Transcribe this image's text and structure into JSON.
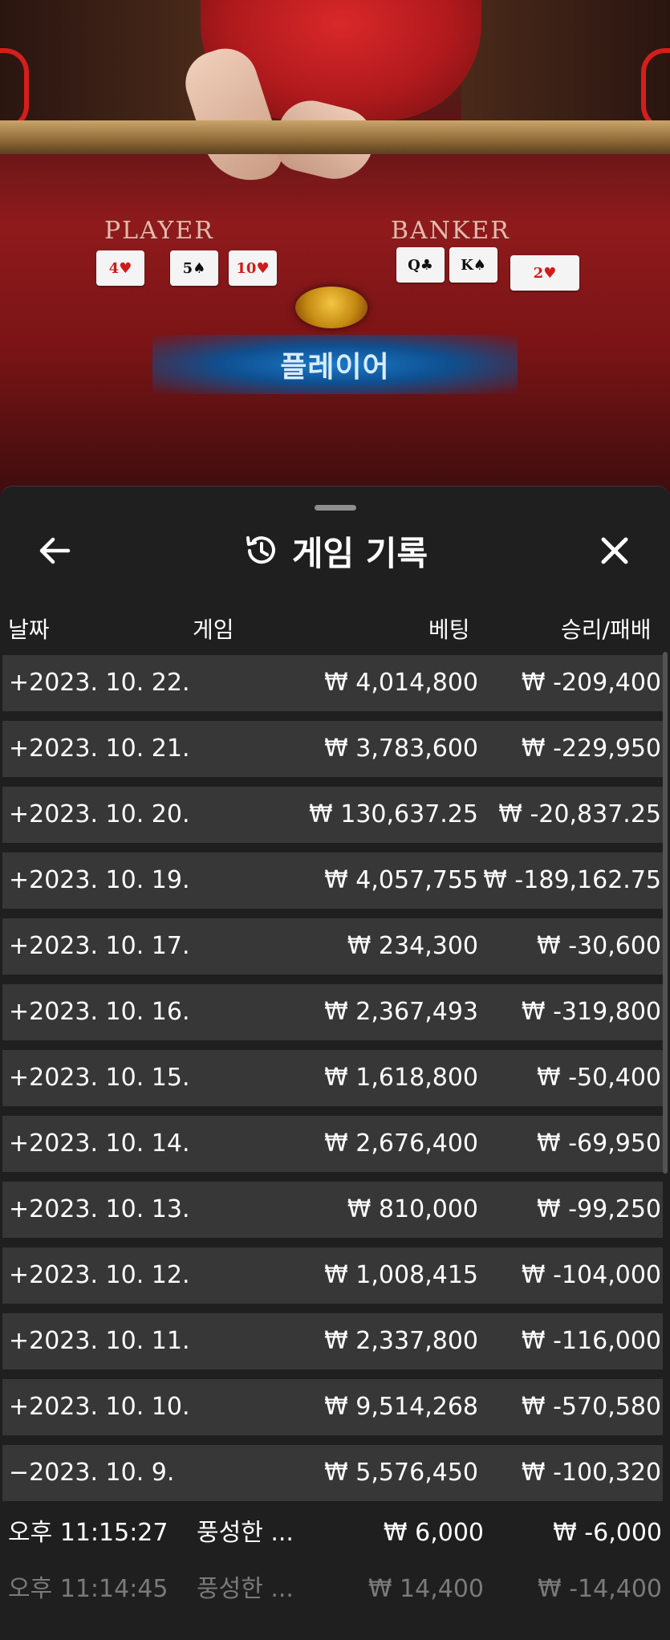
{
  "video": {
    "player_label": "PLAYER",
    "banker_label": "BANKER",
    "player_cards": [
      {
        "rank": "4",
        "suit": "♥",
        "color": "red"
      },
      {
        "rank": "5",
        "suit": "♠",
        "color": "black"
      },
      {
        "rank": "10",
        "suit": "♥",
        "color": "red"
      }
    ],
    "banker_cards": [
      {
        "rank": "Q",
        "suit": "♣",
        "color": "black"
      },
      {
        "rank": "K",
        "suit": "♠",
        "color": "black"
      },
      {
        "rank": "2",
        "suit": "♥",
        "color": "red"
      }
    ],
    "result_banner": "플레이어"
  },
  "sheet": {
    "title": "게임 기록",
    "title_icon": "history-icon",
    "back_icon": "arrow-left-icon",
    "close_icon": "close-icon",
    "columns": {
      "date": "날짜",
      "game": "게임",
      "bet": "베팅",
      "win_loss": "승리/패배"
    },
    "rows": [
      {
        "date": "+2023. 10. 22.",
        "bet": "₩ 4,014,800",
        "win": "₩ -209,400"
      },
      {
        "date": "+2023. 10. 21.",
        "bet": "₩ 3,783,600",
        "win": "₩ -229,950"
      },
      {
        "date": "+2023. 10. 20.",
        "bet": "₩ 130,637.25",
        "win": "₩ -20,837.25"
      },
      {
        "date": "+2023. 10. 19.",
        "bet": "₩ 4,057,755",
        "win": "₩ -189,162.75"
      },
      {
        "date": "+2023. 10. 17.",
        "bet": "₩ 234,300",
        "win": "₩ -30,600"
      },
      {
        "date": "+2023. 10. 16.",
        "bet": "₩ 2,367,493",
        "win": "₩ -319,800"
      },
      {
        "date": "+2023. 10. 15.",
        "bet": "₩ 1,618,800",
        "win": "₩ -50,400"
      },
      {
        "date": "+2023. 10. 14.",
        "bet": "₩ 2,676,400",
        "win": "₩ -69,950"
      },
      {
        "date": "+2023. 10. 13.",
        "bet": "₩ 810,000",
        "win": "₩ -99,250"
      },
      {
        "date": "+2023. 10. 12.",
        "bet": "₩ 1,008,415",
        "win": "₩ -104,000"
      },
      {
        "date": "+2023. 10. 11.",
        "bet": "₩ 2,337,800",
        "win": "₩ -116,000"
      },
      {
        "date": "+2023. 10. 10.",
        "bet": "₩ 9,514,268",
        "win": "₩ -570,580"
      },
      {
        "date": "−2023. 10. 9.",
        "bet": "₩ 5,576,450",
        "win": "₩ -100,320"
      }
    ],
    "sub_rows": [
      {
        "time": "오후 11:15:27",
        "game": "풍성한 ...",
        "bet": "₩ 6,000",
        "win": "₩ -6,000"
      },
      {
        "time": "오후 11:14:45",
        "game": "풍성한 ...",
        "bet": "₩ 14,400",
        "win": "₩ -14,400"
      }
    ]
  }
}
